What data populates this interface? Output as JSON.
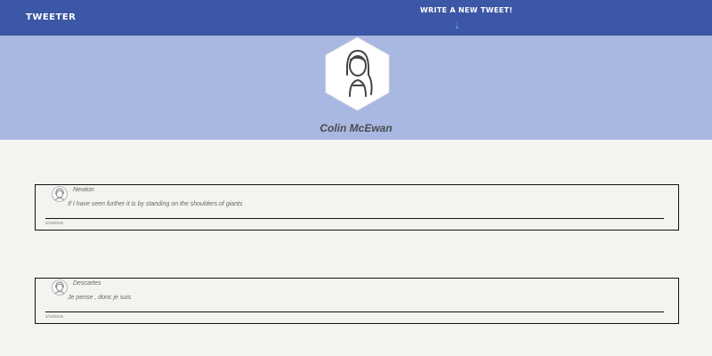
{
  "navbar": {
    "brand": "TWEETER",
    "compose_label": "WRITE A NEW TWEET!",
    "compose_caret": "⇣"
  },
  "profile": {
    "name": "Colin McEwan",
    "avatar_icon": "person-avatar-icon"
  },
  "colors": {
    "navbar_bg": "#3c57a6",
    "hero_bg": "#a9b8e2",
    "page_bg": "#f4f3ef"
  },
  "tweets": [
    {
      "author": "Newton",
      "text": "If I have seen further it is by standing on the shoulders of giants",
      "date": "4/19/2016"
    },
    {
      "author": "Descartes",
      "text": "Je pense , donc je suis",
      "date": "4/19/2016"
    }
  ]
}
